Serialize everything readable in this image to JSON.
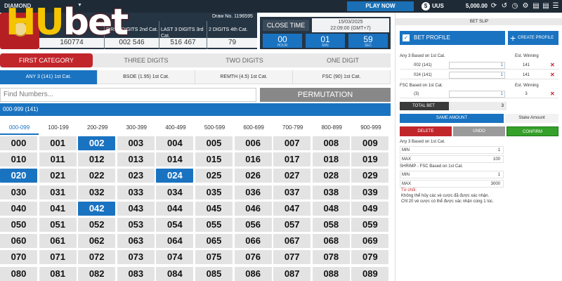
{
  "topbar": {
    "mode": "DIAMOND",
    "play_now": "PLAY NOW",
    "currency": "UUS",
    "balance": "5,000.00",
    "icons": [
      "refresh-icon",
      "history-icon",
      "clock-icon",
      "settings-icon",
      "document-icon",
      "document-icon",
      "list-icon"
    ]
  },
  "logo": {
    "part1": "HU",
    "part2": "bet"
  },
  "draw": {
    "draw_no": "Draw No. 1196595",
    "columns": [
      {
        "label": "",
        "value": "160774"
      },
      {
        "label": "FIRST DIGITS 2nd Cat.",
        "value": "002 546"
      },
      {
        "label": "LAST 3 DIGITS 3rd Cat.",
        "value": "516 467"
      },
      {
        "label": "2 DIGITS 4th Cat.",
        "value": "79"
      }
    ]
  },
  "close": {
    "label": "CLOSE TIME",
    "date": "15/03/2025",
    "time": "22:09:00 (GMT+7)",
    "countdown": [
      {
        "value": "00",
        "unit": "HOUR"
      },
      {
        "value": "01",
        "unit": "MIN"
      },
      {
        "value": "59",
        "unit": "SEC"
      }
    ]
  },
  "categories": [
    "FIRST CATEGORY",
    "THREE DIGITS",
    "TWO DIGITS",
    "ONE DIGIT"
  ],
  "sub_categories": [
    "ANY 3 (141) 1st Cat.",
    "BSOE (1.95) 1st Cat.",
    "REMTH (4.5) 1st Cat.",
    "FSC (90) 1st Cat."
  ],
  "search": {
    "placeholder": "Find Numbers..."
  },
  "permutation_label": "PERMUTATION",
  "range_title": "000-999 (141)",
  "ranges": [
    "000-099",
    "100-199",
    "200-299",
    "300-399",
    "400-499",
    "500-599",
    "600-699",
    "700-799",
    "800-899",
    "900-999"
  ],
  "numbers": [
    [
      "000",
      "001",
      "002",
      "003",
      "004",
      "005",
      "006",
      "007",
      "008",
      "009"
    ],
    [
      "010",
      "011",
      "012",
      "013",
      "014",
      "015",
      "016",
      "017",
      "018",
      "019"
    ],
    [
      "020",
      "021",
      "022",
      "023",
      "024",
      "025",
      "026",
      "027",
      "028",
      "029"
    ],
    [
      "030",
      "031",
      "032",
      "033",
      "034",
      "035",
      "036",
      "037",
      "038",
      "039"
    ],
    [
      "040",
      "041",
      "042",
      "043",
      "044",
      "045",
      "046",
      "047",
      "048",
      "049"
    ],
    [
      "050",
      "051",
      "052",
      "053",
      "054",
      "055",
      "056",
      "057",
      "058",
      "059"
    ],
    [
      "060",
      "061",
      "062",
      "063",
      "064",
      "065",
      "066",
      "067",
      "068",
      "069"
    ],
    [
      "070",
      "071",
      "072",
      "073",
      "074",
      "075",
      "076",
      "077",
      "078",
      "079"
    ],
    [
      "080",
      "081",
      "082",
      "083",
      "084",
      "085",
      "086",
      "087",
      "088",
      "089"
    ]
  ],
  "selected_numbers": [
    "002",
    "020",
    "024",
    "042"
  ],
  "slip": {
    "header": "BET SLIP",
    "bet_profile": "BET PROFILE",
    "create_profile": "CREATE PROFILE",
    "group1_title": "Any 3 Based on 1st Cat.",
    "est_winning": "Est. Winning",
    "bets1": [
      {
        "name": "002 (141)",
        "amount": "1",
        "win": "141"
      },
      {
        "name": "024 (141)",
        "amount": "1",
        "win": "141"
      }
    ],
    "group2_title": "FSC Based on 1st Cat.",
    "bets2": [
      {
        "name": "(3)",
        "amount": "1",
        "win": "3"
      }
    ],
    "total_label": "TOTAL BET",
    "total_value": "3",
    "same_amount": "SAME AMOUNT",
    "stake_amount": "Stake Amount",
    "delete": "DELETE",
    "undo": "UNDO",
    "confirm": "CONFIRM",
    "limit1_title": "Any 3 Based on 1st Cat.",
    "limit1": [
      {
        "k": "MIN",
        "v": "1"
      },
      {
        "k": "MAX",
        "v": "100"
      }
    ],
    "limit2_title": "SHRIMP - FSC Based on 1st Cat.",
    "limit2": [
      {
        "k": "MIN",
        "v": "1"
      },
      {
        "k": "MAX",
        "v": "3000"
      }
    ],
    "error_title": "Từ chối:",
    "error_lines": [
      "Không thể hủy các vé cược đã được xác nhận.",
      "Chỉ 20 vé cược có thể được xác nhận cùng 1 lúc."
    ]
  }
}
